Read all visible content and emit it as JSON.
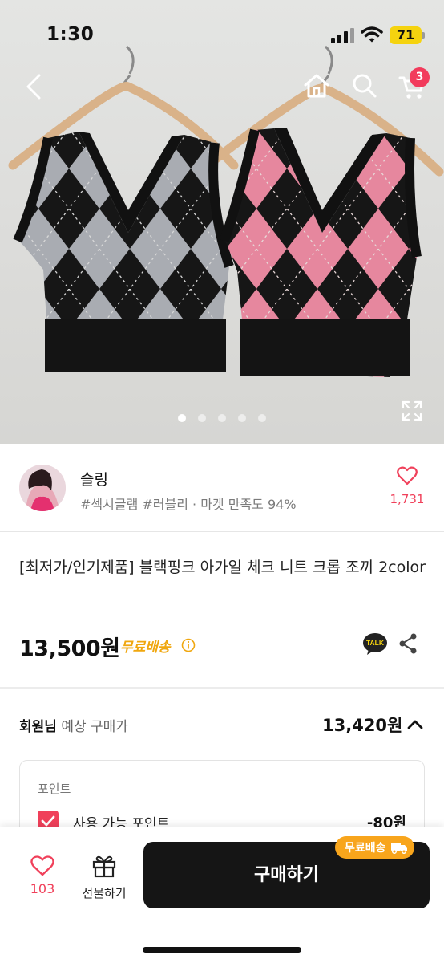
{
  "status_bar": {
    "time": "1:30",
    "battery": "71"
  },
  "top_nav": {
    "cart_count": "3"
  },
  "gallery": {
    "slide_count": 5,
    "active_index": 0
  },
  "seller": {
    "name": "슬링",
    "tags": "#섹시글램 #러블리 · 마켓 만족도 94%",
    "like_count": "1,731"
  },
  "product": {
    "title": "[최저가/인기제품] 블랙핑크 아가일 체크 니트 크롭 조끼 2color",
    "price": "13,500원",
    "shipping": "무료배송"
  },
  "share": {
    "talk_label": "TALK"
  },
  "member_price": {
    "label_bold": "회원님",
    "label_rest": " 예상 구매가",
    "value": "13,420원"
  },
  "points": {
    "title": "포인트",
    "option_label": "사용 가능 포인트",
    "value": "-80원"
  },
  "bottom_bar": {
    "like_count": "103",
    "gift_label": "선물하기",
    "buy_label": "구매하기",
    "shipping_badge": "무료배송"
  },
  "colors": {
    "accent": "#f0405a",
    "shipping": "#f0a70f",
    "buy_button": "#151515",
    "badge": "#f8a51c"
  }
}
